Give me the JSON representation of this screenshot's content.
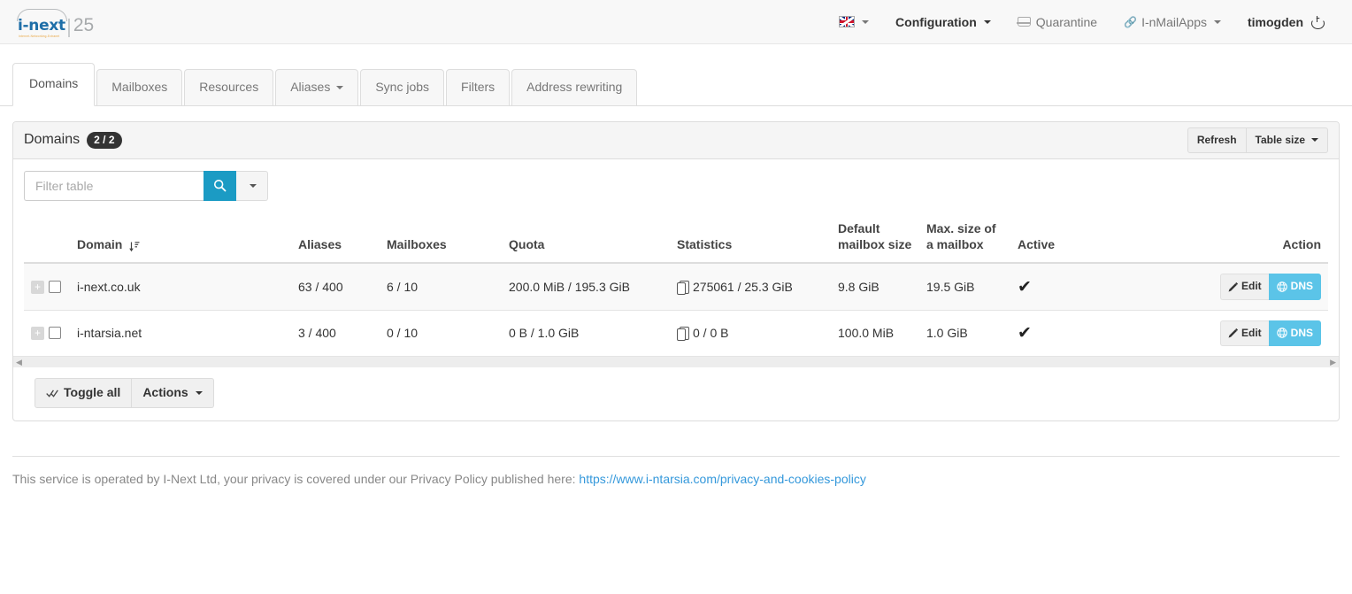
{
  "brand": {
    "name": "i-next",
    "tagline": "Internet-Networking-Extranet",
    "suffix": "25"
  },
  "navbar": {
    "language": {
      "icon": "uk-flag-icon",
      "label": ""
    },
    "items": [
      {
        "label": "Configuration",
        "icon": "",
        "has_caret": true,
        "muted": false
      },
      {
        "label": "Quarantine",
        "icon": "inbox-icon",
        "has_caret": false,
        "muted": true
      },
      {
        "label": "I-nMailApps",
        "icon": "link-icon",
        "has_caret": true,
        "muted": true
      },
      {
        "label": "timogden",
        "icon": "power-icon",
        "has_caret": false,
        "muted": false
      }
    ]
  },
  "tabs": [
    {
      "label": "Domains",
      "active": true,
      "caret": false
    },
    {
      "label": "Mailboxes",
      "active": false,
      "caret": false
    },
    {
      "label": "Resources",
      "active": false,
      "caret": false
    },
    {
      "label": "Aliases",
      "active": false,
      "caret": true
    },
    {
      "label": "Sync jobs",
      "active": false,
      "caret": false
    },
    {
      "label": "Filters",
      "active": false,
      "caret": false
    },
    {
      "label": "Address rewriting",
      "active": false,
      "caret": false
    }
  ],
  "panel": {
    "title": "Domains",
    "badge": "2 / 2",
    "refresh_label": "Refresh",
    "table_size_label": "Table size"
  },
  "filter": {
    "placeholder": "Filter table",
    "value": "",
    "search_icon": "search-icon",
    "accent_color": "#1b9bc4"
  },
  "table": {
    "headers": [
      "Domain",
      "Aliases",
      "Mailboxes",
      "Quota",
      "Statistics",
      "Default mailbox size",
      "Max. size of a mailbox",
      "Active",
      "Action"
    ],
    "sort_column": "Domain",
    "rows": [
      {
        "domain": "i-next.co.uk",
        "aliases": "63 / 400",
        "mailboxes": "6 / 10",
        "quota": "200.0 MiB / 195.3 GiB",
        "statistics": "275061 / 25.3 GiB",
        "default_mailbox_size": "9.8 GiB",
        "max_mailbox_size": "19.5 GiB",
        "active": "✔",
        "edit_label": "Edit",
        "dns_label": "DNS"
      },
      {
        "domain": "i-ntarsia.net",
        "aliases": "3 / 400",
        "mailboxes": "0 / 10",
        "quota": "0 B / 1.0 GiB",
        "statistics": "0 / 0 B",
        "default_mailbox_size": "100.0 MiB",
        "max_mailbox_size": "1.0 GiB",
        "active": "✔",
        "edit_label": "Edit",
        "dns_label": "DNS"
      }
    ]
  },
  "footer_controls": {
    "toggle_all_label": "Toggle all",
    "actions_label": "Actions"
  },
  "page_footer": {
    "text": "This service is operated by I-Next Ltd, your privacy is covered under our Privacy Policy published here:",
    "link_text": "https://www.i-ntarsia.com/privacy-and-cookies-policy"
  }
}
